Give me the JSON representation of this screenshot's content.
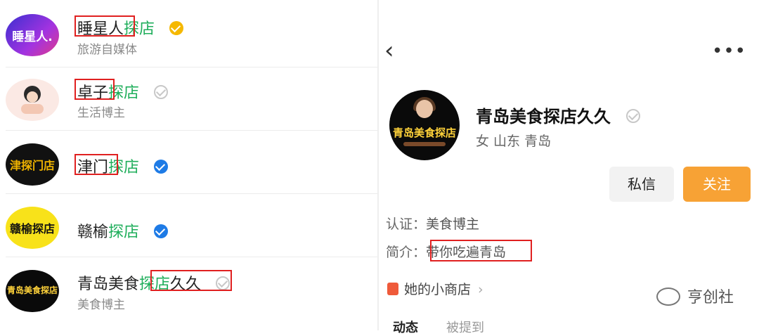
{
  "results": [
    {
      "name_a": "睡星人",
      "name_b": "探店",
      "sub": "旅游自媒体",
      "avatar_text": "睡星人.",
      "badge": "gold-verified-icon"
    },
    {
      "name_a": "卓子",
      "name_b": "探店",
      "sub": "生活博主",
      "avatar_text": "",
      "badge": "gray-verified-icon"
    },
    {
      "name_a": "津门",
      "name_b": "探店",
      "sub": "",
      "avatar_text": "津探门店",
      "badge": "blue-verified-icon"
    },
    {
      "name_a": "赣榆",
      "name_b": "探店",
      "sub": "",
      "avatar_text": "赣榆探店",
      "badge": "blue-verified-icon"
    },
    {
      "name_a": "青岛美食",
      "name_b": "探店",
      "name_c": "久久",
      "sub": "美食博主",
      "avatar_text": "青岛美食探店",
      "badge": "gray-verified-icon"
    }
  ],
  "profile": {
    "back_icon": "back-chevron-icon",
    "more_icon": "more-dots-icon",
    "avatar_text": "青岛美食探店",
    "name": "青岛美食探店久久",
    "meta": "女 山东 青岛",
    "message_label": "私信",
    "follow_label": "关注",
    "cert_label": "认证：",
    "cert_value": "美食博主",
    "intro_label": "简介：",
    "intro_value": "带你吃遍青岛",
    "shop_label": "她的小商店",
    "tabs": [
      "动态",
      "被提到"
    ]
  },
  "watermark": "亨创社",
  "colors": {
    "green": "#1fae5b",
    "follow": "#f7a235",
    "highlight": "#e02020"
  }
}
